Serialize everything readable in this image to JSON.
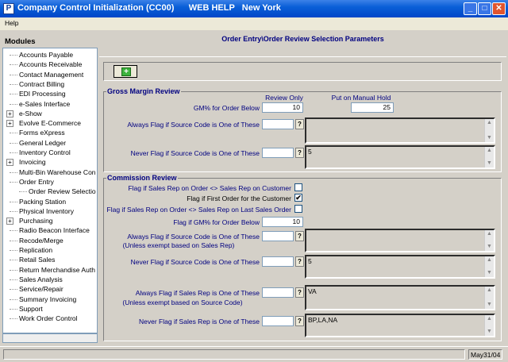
{
  "window": {
    "title": "Company Control Initialization (CC00)      WEB HELP   New York",
    "app_icon": "P",
    "minimize": "_",
    "maximize": "□",
    "close": "✕"
  },
  "menu": {
    "help": "Help"
  },
  "sidebar": {
    "heading": "Modules",
    "items": [
      {
        "label": "Accounts Payable",
        "expand": false
      },
      {
        "label": "Accounts Receivable",
        "expand": false
      },
      {
        "label": "Contact Management",
        "expand": false
      },
      {
        "label": "Contract Billing",
        "expand": false
      },
      {
        "label": "EDI Processing",
        "expand": false
      },
      {
        "label": "e-Sales Interface",
        "expand": false
      },
      {
        "label": "e-Show",
        "expand": true
      },
      {
        "label": "Evolve E-Commerce",
        "expand": true
      },
      {
        "label": "Forms eXpress",
        "expand": false
      },
      {
        "label": "General Ledger",
        "expand": false
      },
      {
        "label": "Inventory Control",
        "expand": false
      },
      {
        "label": "Invoicing",
        "expand": true
      },
      {
        "label": "Multi-Bin Warehouse Con",
        "expand": false
      },
      {
        "label": "Order Entry",
        "expand": false
      },
      {
        "label": "Order Review Selectio",
        "expand": false,
        "child": true
      },
      {
        "label": "Packing Station",
        "expand": false
      },
      {
        "label": "Physical Inventory",
        "expand": false
      },
      {
        "label": "Purchasing",
        "expand": true
      },
      {
        "label": "Radio Beacon Interface",
        "expand": false
      },
      {
        "label": "Recode/Merge",
        "expand": false
      },
      {
        "label": "Replication",
        "expand": false
      },
      {
        "label": "Retail Sales",
        "expand": false
      },
      {
        "label": "Return Merchandise Auth",
        "expand": false
      },
      {
        "label": "Sales Analysis",
        "expand": false
      },
      {
        "label": "Service/Repair",
        "expand": false
      },
      {
        "label": "Summary Invoicing",
        "expand": false
      },
      {
        "label": "Support",
        "expand": false
      },
      {
        "label": "Work Order Control",
        "expand": false
      }
    ]
  },
  "page": {
    "title": "Order Entry\\Order Review Selection Parameters",
    "add_icon": "plus-icon"
  },
  "gross_margin": {
    "title": "Gross Margin Review",
    "col_review_only": "Review Only",
    "col_manual_hold": "Put on Manual Hold",
    "gm_label": "GM% for Order Below",
    "gm_review_value": "10",
    "gm_hold_value": "25",
    "always_label": "Always Flag if Source Code is One of These",
    "always_list": "",
    "never_label": "Never Flag if Source Code is One of These",
    "never_list": "5"
  },
  "commission": {
    "title": "Commission Review",
    "flag_rep_customer": "Flag if Sales Rep on Order <> Sales Rep on Customer",
    "flag_rep_customer_checked": false,
    "flag_first_order": "Flag if First Order for the Customer",
    "flag_first_order_checked": true,
    "flag_rep_last": "Flag if Sales Rep on Order <> Sales Rep on Last Sales Order",
    "flag_rep_last_checked": false,
    "flag_gm_label": "Flag if GM% for Order Below",
    "flag_gm_value": "10",
    "always_src_label": "Always Flag if Source Code is One of These",
    "always_src_sub": "(Unless exempt based on Sales Rep)",
    "always_src_list": "",
    "never_src_label": "Never Flag if Source Code is One of These",
    "never_src_list": "5",
    "always_rep_label": "Always Flag if Sales Rep is One of These",
    "always_rep_sub": "(Unless exempt based on Source Code)",
    "always_rep_list": "VA",
    "never_rep_label": "Never Flag if Sales Rep is One of These",
    "never_rep_list": "BP,LA,NA",
    "lookup": "?",
    "check_mark": "✔"
  },
  "status": {
    "date": "May31/04"
  }
}
